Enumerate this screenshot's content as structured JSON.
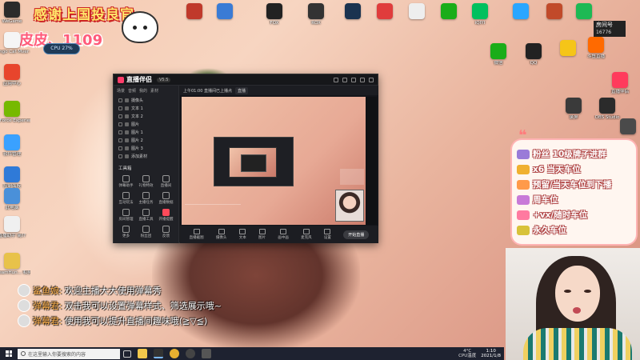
{
  "banner": {
    "title": "感谢上国投良官",
    "subtitle": "皮皮、1109",
    "cpu_label": "CPU 27%"
  },
  "desktop_icons_left": [
    {
      "name": "wegame-icon",
      "label": "WeGame",
      "color": "#2b2b2b"
    },
    {
      "name": "bongo-cat-icon",
      "label": "Bongo Cat Mver - Bi...",
      "color": "#f5f5f5"
    },
    {
      "name": "app-center-icon",
      "label": "应用中心",
      "color": "#e8452c"
    },
    {
      "name": "geforce-icon",
      "label": "GeForce Experience",
      "color": "#76b900"
    },
    {
      "name": "software-manager-icon",
      "label": "软件管理",
      "color": "#3aa1ff"
    },
    {
      "name": "control-panel-icon",
      "label": "控制面板",
      "color": "#2f7ad8"
    },
    {
      "name": "this-pc-icon",
      "label": "此电脑",
      "color": "#4a90d9"
    },
    {
      "name": "douyu-tool-icon",
      "label": "直播助手 简介",
      "color": "#f0f0f0"
    },
    {
      "name": "dreamhun-icon",
      "label": "DreamHun... 和剪 mod...",
      "color": "#e8c24a"
    }
  ],
  "desktop_icons_top": [
    {
      "name": "game-a-icon",
      "label": "",
      "color": "#c0392b"
    },
    {
      "name": "feather-icon",
      "label": "",
      "color": "#3a7bd5"
    },
    {
      "name": "fox-icon",
      "label": "FOX",
      "color": "#222"
    },
    {
      "name": "rox-icon",
      "label": "ROX",
      "color": "#333"
    },
    {
      "name": "lol-icon",
      "label": "",
      "color": "#1a3350"
    },
    {
      "name": "red-bird-icon",
      "label": "",
      "color": "#e03c3c"
    },
    {
      "name": "files-icon",
      "label": "",
      "color": "#eee"
    },
    {
      "name": "wechat-icon",
      "label": "",
      "color": "#1aad19"
    },
    {
      "name": "iqiyi-icon",
      "label": "iQIYI",
      "color": "#00c05e"
    },
    {
      "name": "tencent-video-icon",
      "label": "",
      "color": "#2aa6ff"
    },
    {
      "name": "pirate-icon",
      "label": "",
      "color": "#c14a2a"
    },
    {
      "name": "music-icon",
      "label": "",
      "color": "#1db954"
    }
  ],
  "desktop_icons_right": [
    {
      "name": "wechat-right-icon",
      "label": "微信",
      "color": "#1aad19"
    },
    {
      "name": "qq-icon",
      "label": "QQ",
      "color": "#222"
    },
    {
      "name": "douyin-icon",
      "label": "",
      "color": "#f5c518"
    },
    {
      "name": "streaming-icon",
      "label": "斗鱼直播",
      "color": "#ff6a00"
    },
    {
      "name": "live-partner-icon",
      "label": "直播伴侣",
      "color": "#ff3b5c"
    },
    {
      "name": "recorder-icon",
      "label": "录屏",
      "color": "#3a3a3a"
    },
    {
      "name": "obs-icon",
      "label": "OBS Studio",
      "color": "#2b2b2b"
    },
    {
      "name": "cam-icon",
      "label": "",
      "color": "#4a4a4a"
    }
  ],
  "room_badge": {
    "label": "房间号",
    "value": "16776"
  },
  "app": {
    "logo": "直播伴侣",
    "badge": "V5.5",
    "side_tabs": [
      "场景",
      "音频",
      "我的",
      "素材"
    ],
    "scenes": [
      "摄像头",
      "文本 1",
      "文本 2",
      "图片",
      "图片 1",
      "图片 2",
      "图片 3",
      "添加素材"
    ],
    "tools_title": "工具箱",
    "tools": [
      {
        "label": "弹幕助手",
        "hot": false
      },
      {
        "label": "礼物特效",
        "hot": false
      },
      {
        "label": "直播间",
        "hot": false
      },
      {
        "label": "互动玩法",
        "hot": false
      },
      {
        "label": "主播任务",
        "hot": false
      },
      {
        "label": "直播数据",
        "hot": false
      },
      {
        "label": "房间管理",
        "hot": false
      },
      {
        "label": "直播工具",
        "hot": false
      },
      {
        "label": "开播提醒",
        "hot": true
      },
      {
        "label": "更多",
        "hot": false
      },
      {
        "label": "粉丝团",
        "hot": false
      },
      {
        "label": "反馈",
        "hot": false
      }
    ],
    "main_top_text": "上午01:00 直播间已上播点",
    "main_top_tab": "直播",
    "bottom_tools": [
      "直播截图",
      "摄像头",
      "文本",
      "图片",
      "画中画",
      "麦克风",
      "设置"
    ],
    "start_live_label": "开始直播"
  },
  "right_panel": {
    "deco": "❝",
    "lines": [
      {
        "text": "粉丝 10级牌子进群",
        "icon_color": "#9a7bd8"
      },
      {
        "text": "x6 当天车位",
        "icon_color": "#f0b030"
      },
      {
        "text": "预留/当天车位到下播",
        "icon_color": "#ff9a4a"
      },
      {
        "text": "周车位",
        "icon_color": "#c87ad8"
      },
      {
        "text": "+vx/随时车位",
        "icon_color": "#ff7aa0"
      },
      {
        "text": "永久车位",
        "icon_color": "#d8c23a"
      }
    ]
  },
  "chat": [
    {
      "name": "鲨鱼娘:",
      "message": "欢迎主播大大使用弹幕秀"
    },
    {
      "name": "弹幕君:",
      "message": "双击我可以设置弹幕样式、筛选展示哦~"
    },
    {
      "name": "弹幕君:",
      "message": "使用我可以提升直播间趣味哦(≧▽≦)"
    }
  ],
  "taskbar": {
    "search_placeholder": "在这里输入你要搜索的内容",
    "weather": "4°C",
    "weather_sub": "CPU温度",
    "time": "1:10",
    "date": "2021/1/8"
  }
}
